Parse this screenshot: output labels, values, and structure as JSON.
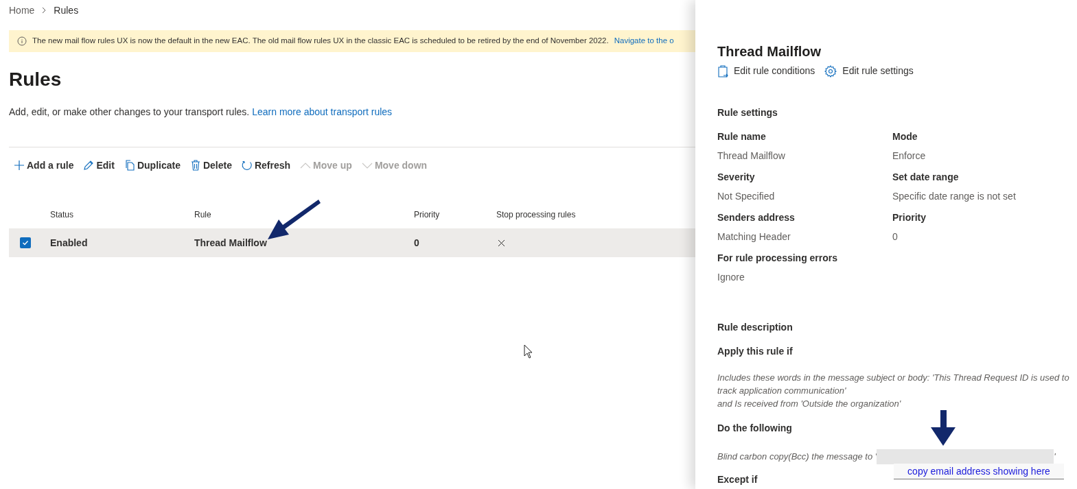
{
  "breadcrumb": [
    "Home",
    "Rules"
  ],
  "banner": {
    "text": "The new mail flow rules UX is now the default in the new EAC. The old mail flow rules UX in the classic EAC is scheduled to be retired by the end of November 2022.",
    "link": "Navigate to the o"
  },
  "page_title": "Rules",
  "description": {
    "text": "Add, edit, or make other changes to your transport rules.",
    "link": "Learn more about transport rules"
  },
  "toolbar": [
    {
      "kind": "add",
      "label": "Add a rule",
      "disabled": false
    },
    {
      "kind": "edit",
      "label": "Edit",
      "disabled": false
    },
    {
      "kind": "duplicate",
      "label": "Duplicate",
      "disabled": false
    },
    {
      "kind": "delete",
      "label": "Delete",
      "disabled": false
    },
    {
      "kind": "refresh",
      "label": "Refresh",
      "disabled": false
    },
    {
      "kind": "up",
      "label": "Move up",
      "disabled": true
    },
    {
      "kind": "down",
      "label": "Move down",
      "disabled": true
    }
  ],
  "table": {
    "columns": [
      "Status",
      "Rule",
      "Priority",
      "Stop processing rules"
    ],
    "rows": [
      {
        "selected": true,
        "status": "Enabled",
        "rule": "Thread Mailflow",
        "priority": "0",
        "stop_processing": false
      }
    ]
  },
  "panel": {
    "title": "Thread Mailflow",
    "actions": [
      {
        "kind": "conditions",
        "label": "Edit rule conditions"
      },
      {
        "kind": "settings",
        "label": "Edit rule settings"
      }
    ],
    "settings_heading": "Rule settings",
    "settings": [
      {
        "label": "Rule name",
        "value": "Thread Mailflow"
      },
      {
        "label": "Mode",
        "value": "Enforce"
      },
      {
        "label": "Severity",
        "value": "Not Specified"
      },
      {
        "label": "Set date range",
        "value": "Specific date range is not set"
      },
      {
        "label": "Senders address",
        "value": "Matching Header"
      },
      {
        "label": "Priority",
        "value": "0"
      },
      {
        "label": "For rule processing errors",
        "value": "Ignore"
      }
    ],
    "description_heading": "Rule description",
    "apply_heading": "Apply this rule if",
    "apply_lines": [
      "Includes these words in the message subject or body: 'This Thread Request ID is used to track application communication'",
      "and Is received from 'Outside the organization'"
    ],
    "do_heading": "Do the following",
    "do_text_start": "Blind carbon copy(Bcc) the message to '",
    "do_text_end": "'",
    "except_heading": "Except if"
  },
  "callout": "copy email address showing here"
}
